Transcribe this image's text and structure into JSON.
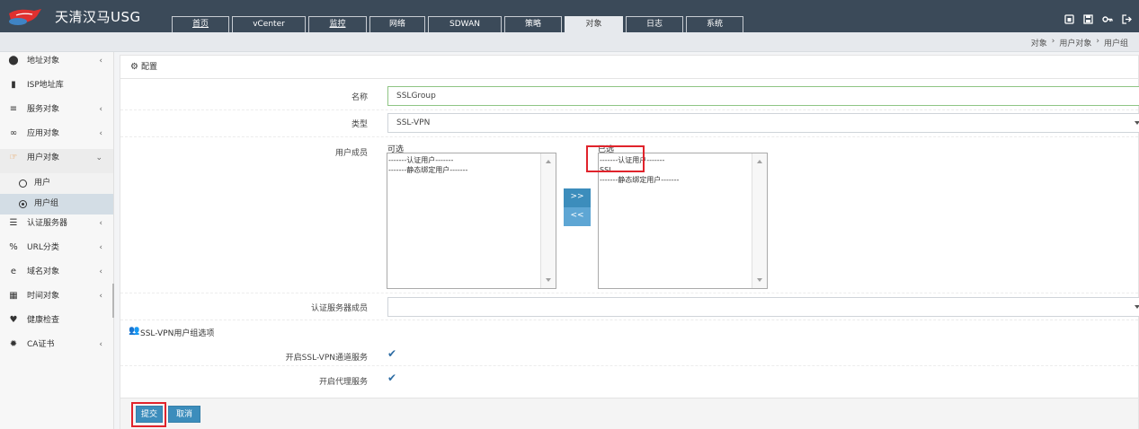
{
  "brand": {
    "title": "天清汉马USG",
    "logo": "logo-icon"
  },
  "nav": {
    "tabs": [
      {
        "label": "首页",
        "underlined": true
      },
      {
        "label": "vCenter",
        "underlined": false
      },
      {
        "label": "监控",
        "underlined": true
      },
      {
        "label": "网络",
        "underlined": false
      },
      {
        "label": "SDWAN",
        "underlined": false
      },
      {
        "label": "策略",
        "underlined": false
      },
      {
        "label": "对象",
        "underlined": false,
        "active": true
      },
      {
        "label": "日志",
        "underlined": false
      },
      {
        "label": "系统",
        "underlined": false
      }
    ],
    "icons": [
      "lock-icon",
      "save-icon",
      "key-icon",
      "logout-icon"
    ]
  },
  "breadcrumb": {
    "items": [
      "对象",
      "用户对象",
      "用户组"
    ],
    "separator": "›"
  },
  "sidebar": {
    "items": [
      {
        "label": "地址对象",
        "icon": "map-marker-icon",
        "arrow": "‹"
      },
      {
        "label": "ISP地址库",
        "icon": "map-icon",
        "arrow": ""
      },
      {
        "label": "服务对象",
        "icon": "list-icon",
        "arrow": "‹"
      },
      {
        "label": "应用对象",
        "icon": "link-icon",
        "arrow": "‹"
      },
      {
        "label": "用户对象",
        "icon": "user-hand-icon",
        "arrow": "⌄",
        "open": true
      },
      {
        "label": "认证服务器",
        "icon": "server-icon",
        "arrow": "‹"
      },
      {
        "label": "URL分类",
        "icon": "url-icon",
        "arrow": "‹"
      },
      {
        "label": "域名对象",
        "icon": "globe-icon",
        "arrow": "‹"
      },
      {
        "label": "时间对象",
        "icon": "calendar-icon",
        "arrow": "‹"
      },
      {
        "label": "健康检查",
        "icon": "heartbeat-icon",
        "arrow": ""
      },
      {
        "label": "CA证书",
        "icon": "certificate-icon",
        "arrow": "‹"
      }
    ],
    "subitems": [
      {
        "label": "用户",
        "active": false
      },
      {
        "label": "用户组",
        "active": true
      }
    ]
  },
  "panel": {
    "title": "配置",
    "name_label": "名称",
    "name_value": "SSLGroup",
    "type_label": "类型",
    "type_value": "SSL-VPN",
    "members_label": "用户成员",
    "available_label": "可选",
    "available_options": [
      "-------认证用户-------",
      "-------静态绑定用户-------"
    ],
    "selected_label": "已选",
    "selected_options": [
      "-------认证用户-------",
      "SSL",
      "-------静态绑定用户-------"
    ],
    "add_button": ">>",
    "remove_button": "<<",
    "auth_server_label": "认证服务器成员",
    "auth_server_value": "",
    "sslvpn_section_title": "SSL-VPN用户组选项",
    "enable_tunnel_label": "开启SSL-VPN通道服务",
    "enable_tunnel_checked": true,
    "enable_proxy_label": "开启代理服务",
    "enable_proxy_checked": true,
    "submit_label": "提交",
    "cancel_label": "取消"
  }
}
